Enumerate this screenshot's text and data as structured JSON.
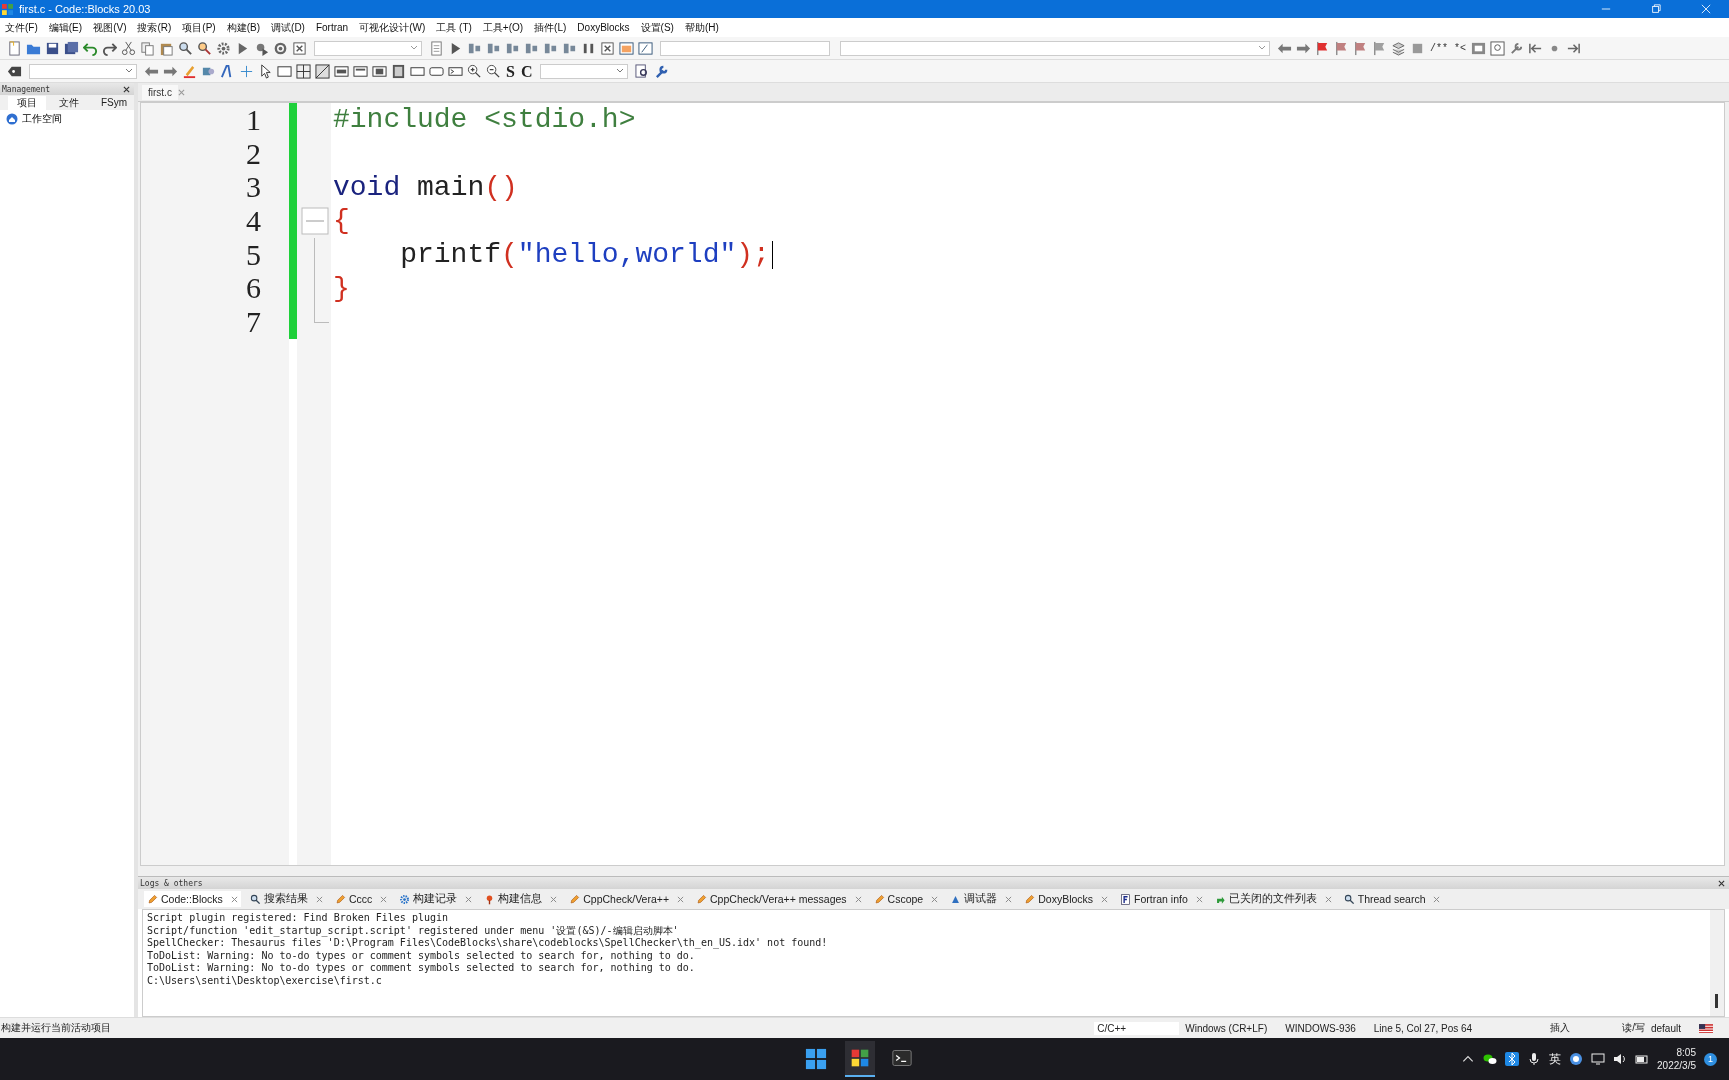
{
  "window": {
    "title": "first.c - Code::Blocks 20.03"
  },
  "menu": [
    "文件(F)",
    "编辑(E)",
    "视图(V)",
    "搜索(R)",
    "项目(P)",
    "构建(B)",
    "调试(D)",
    "Fortran",
    "可视化设计(W)",
    "工具 (T)",
    "工具+(O)",
    "插件(L)",
    "DoxyBlocks",
    "设置(S)",
    "帮助(H)"
  ],
  "toolbar_texts": {
    "symbol_s": "S",
    "symbol_c": "C",
    "doc_block": "/**",
    "doc_line": "*<"
  },
  "management": {
    "title": "Management",
    "tabs": [
      {
        "label": "项目",
        "selected": true
      },
      {
        "label": "文件",
        "selected": false
      },
      {
        "label": "FSym",
        "selected": false
      }
    ],
    "tree": [
      {
        "label": "工作空间"
      }
    ]
  },
  "editor": {
    "tabs": [
      {
        "label": "first.c",
        "selected": true
      }
    ],
    "lines": [
      {
        "number": "1",
        "tokens": [
          {
            "kind": "preprocessor",
            "text": "#include <stdio.h>"
          }
        ]
      },
      {
        "number": "2"
      },
      {
        "number": "3",
        "tokens": [
          {
            "kind": "keyword",
            "text": "void"
          },
          {
            "kind": "plain",
            "text": " main"
          },
          {
            "kind": "operator",
            "text": "()"
          }
        ]
      },
      {
        "number": "4",
        "tokens": [
          {
            "kind": "operator",
            "text": "{"
          }
        ],
        "fold": true
      },
      {
        "number": "5",
        "tokens": [
          {
            "kind": "plain",
            "text": "    printf"
          },
          {
            "kind": "operator",
            "text": "("
          },
          {
            "kind": "string",
            "text": "\"hello,world\""
          },
          {
            "kind": "operator",
            "text": ");"
          }
        ],
        "cursor": true
      },
      {
        "number": "6",
        "tokens": [
          {
            "kind": "operator",
            "text": "}"
          }
        ]
      },
      {
        "number": "7"
      }
    ]
  },
  "logs": {
    "title": "Logs & others",
    "tabs": [
      {
        "kind": "pencil",
        "label": "Code::Blocks",
        "selected": true
      },
      {
        "kind": "search",
        "label": "搜索结果",
        "selected": false
      },
      {
        "kind": "pencil",
        "label": "Cccc",
        "selected": false
      },
      {
        "kind": "gear",
        "label": "构建记录",
        "selected": false
      },
      {
        "kind": "pin",
        "label": "构建信息",
        "selected": false
      },
      {
        "kind": "pencil",
        "label": "CppCheck/Vera++",
        "selected": false
      },
      {
        "kind": "pencil",
        "label": "CppCheck/Vera++ messages",
        "selected": false
      },
      {
        "kind": "pencil",
        "label": "Cscope",
        "selected": false
      },
      {
        "kind": "bug",
        "label": "调试器",
        "selected": false
      },
      {
        "kind": "pencil",
        "label": "DoxyBlocks",
        "selected": false
      },
      {
        "kind": "letter",
        "label": "Fortran info",
        "selected": false
      },
      {
        "kind": "arrow",
        "label": "已关闭的文件列表",
        "selected": false
      },
      {
        "kind": "search",
        "label": "Thread search",
        "selected": false
      }
    ],
    "lines": [
      "Script plugin registered: Find Broken Files plugin",
      "Script/function 'edit_startup_script.script' registered under menu '设置(&S)/-编辑启动脚本'",
      "SpellChecker: Thesaurus files 'D:\\Program Files\\CodeBlocks\\share\\codeblocks\\SpellChecker\\th_en_US.idx' not found!",
      "ToDoList: Warning: No to-do types or comment symbols selected to search for, nothing to do.",
      "ToDoList: Warning: No to-do types or comment symbols selected to search for, nothing to do.",
      "C:\\Users\\senti\\Desktop\\exercise\\first.c"
    ]
  },
  "status_bar": {
    "hint": "构建并运行当前活动项目",
    "language": "C/C++",
    "line_endings": "Windows (CR+LF)",
    "encoding": "WINDOWS-936",
    "position": "Line 5, Col 27, Pos 64",
    "mode": "插入",
    "access": "读/写",
    "theme": "default"
  },
  "taskbar": {
    "apps": [
      {
        "kind": "blocks",
        "selected": true
      },
      {
        "kind": "terminal",
        "selected": false
      }
    ],
    "ime": "英",
    "time": "8:05",
    "date": "2022/3/5",
    "notifications": "1"
  }
}
